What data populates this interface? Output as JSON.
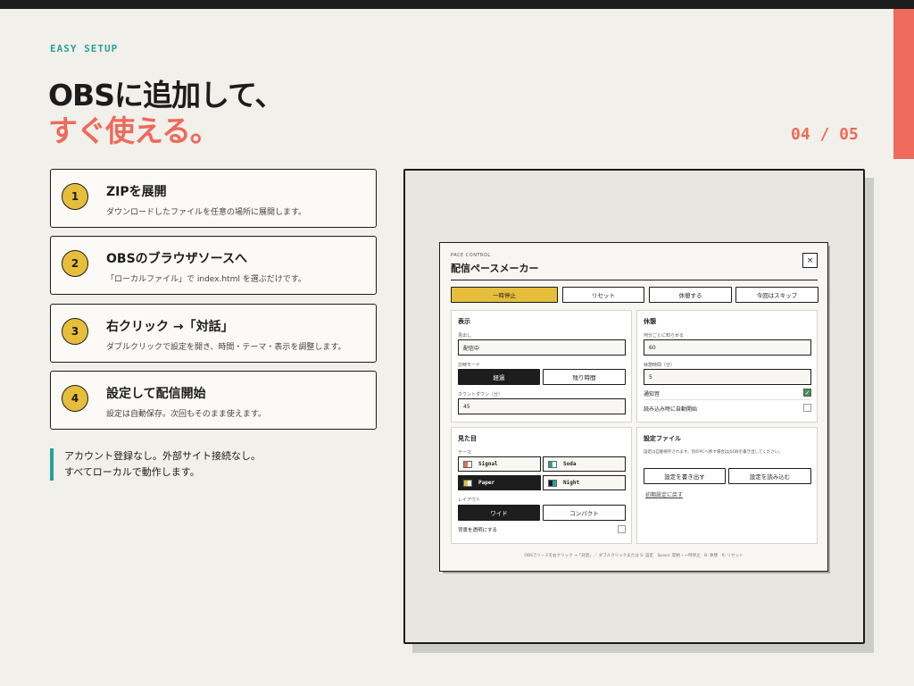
{
  "slide": {
    "eyebrow": "EASY SETUP",
    "title_line1": "OBSに追加して、",
    "title_line2": "すぐ使える。",
    "pager": "04 / 05"
  },
  "steps": [
    {
      "num": "1",
      "title": "ZIPを展開",
      "desc": "ダウンロードしたファイルを任意の場所に展開します。"
    },
    {
      "num": "2",
      "title": "OBSのブラウザソースへ",
      "desc": "「ローカルファイル」で index.html を選ぶだけです。"
    },
    {
      "num": "3",
      "title": "右クリック →「対話」",
      "desc": "ダブルクリックで設定を開き、時間・テーマ・表示を調整します。"
    },
    {
      "num": "4",
      "title": "設定して配信開始",
      "desc": "設定は自動保存。次回もそのまま使えます。"
    }
  ],
  "note": {
    "line1": "アカウント登録なし。外部サイト接続なし。",
    "line2": "すべてローカルで動作します。"
  },
  "app": {
    "eyebrow": "PACE CONTROL",
    "title": "配信ペースメーカー",
    "close": "×",
    "actions": {
      "pause": "一時停止",
      "reset": "リセット",
      "break": "休憩する",
      "skip": "今回はスキップ"
    },
    "display": {
      "heading": "表示",
      "caption_label": "見出し",
      "caption_value": "配信中",
      "mode_label": "計時モード",
      "mode_elapsed": "経過",
      "mode_remaining": "残り時間",
      "countdown_label": "カウントダウン（分）",
      "countdown_value": "45"
    },
    "rest": {
      "heading": "休憩",
      "interval_label": "何分ごとに知らせる",
      "interval_value": "60",
      "duration_label": "休憩時間（分）",
      "duration_value": "5",
      "sound_label": "通知音",
      "sound_checked": true,
      "autostart_label": "読み込み時に自動開始",
      "autostart_checked": false
    },
    "appearance": {
      "heading": "見た目",
      "theme_label": "テーマ",
      "themes": [
        "Signal",
        "Soda",
        "Paper",
        "Night"
      ],
      "selected_theme": "Paper",
      "layout_label": "レイアウト",
      "layout_wide": "ワイド",
      "layout_compact": "コンパクト",
      "transparent_label": "背景を透明にする",
      "transparent_checked": false
    },
    "settings_file": {
      "heading": "設定ファイル",
      "desc": "設定は自動保存されます。別のPCへ移す場合はJSONを書き出してください。",
      "export": "設定を書き出す",
      "import": "設定を読み込む",
      "reset_link": "初期設定に戻す"
    },
    "footer": "OBSでソースを右クリック →「対話」／ ダブルクリックまたは S: 設定　Space: 開始・一時停止　B: 休憩　R: リセット"
  },
  "colors": {
    "accent": "#ee6a5c",
    "teal": "#2aa198",
    "yellow": "#e6be3c",
    "dark": "#1d1d1d",
    "background": "#f2f0eb"
  }
}
